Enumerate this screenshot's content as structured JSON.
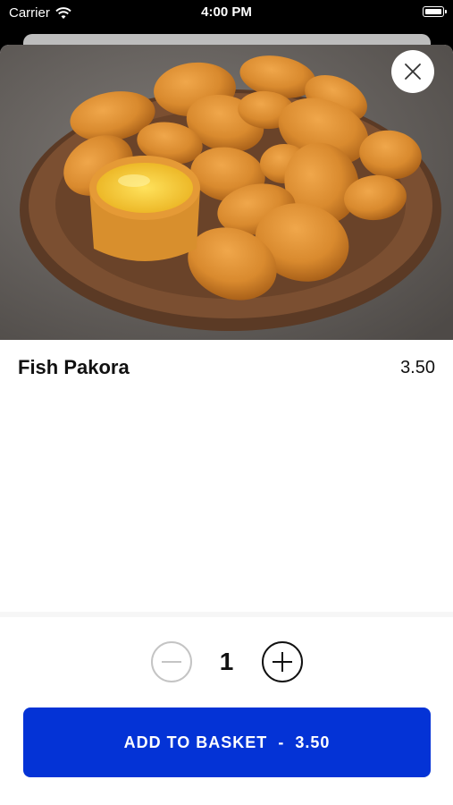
{
  "status_bar": {
    "carrier": "Carrier",
    "time": "4:00 PM"
  },
  "item": {
    "name": "Fish Pakora",
    "price": "3.50",
    "image": "fried fish pakora on wooden plate with dipping sauce"
  },
  "quantity": {
    "value": "1"
  },
  "add_button": {
    "label": "ADD TO BASKET",
    "separator": "-",
    "price": "3.50"
  },
  "colors": {
    "accent": "#0433d6",
    "background": "#ffffff"
  },
  "icons": {
    "close": "close-icon",
    "minus": "minus-icon",
    "plus": "plus-icon",
    "wifi": "wifi-icon",
    "battery": "battery-icon"
  }
}
